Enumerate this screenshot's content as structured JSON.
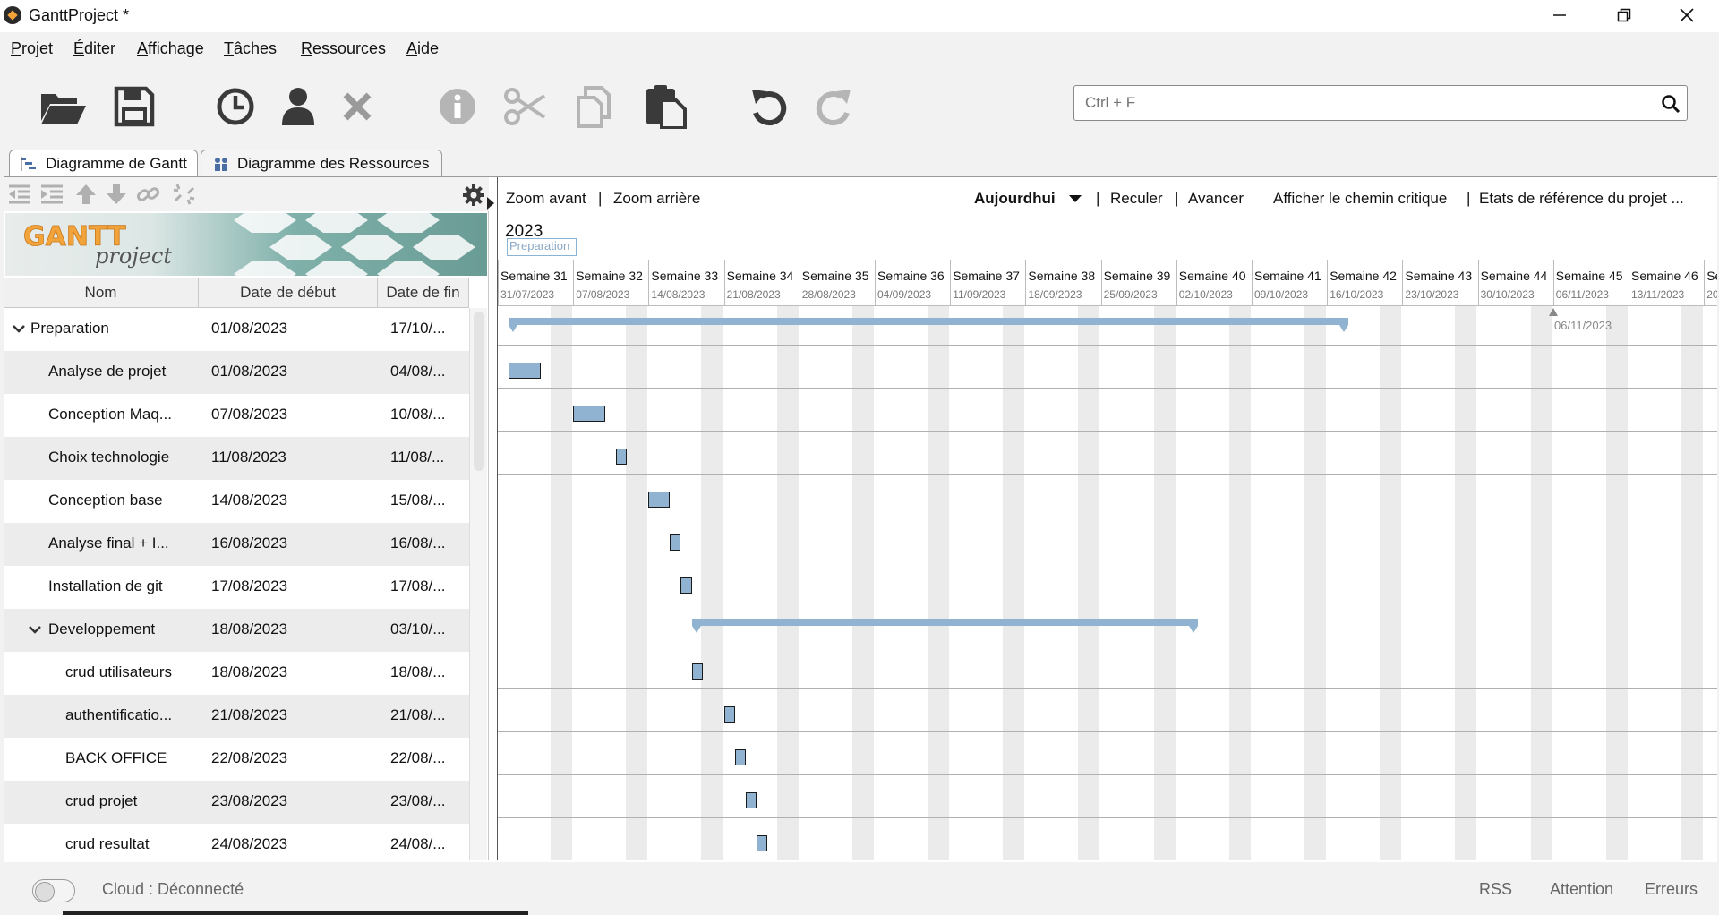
{
  "window": {
    "title": "GanttProject *"
  },
  "menu": [
    {
      "first": "P",
      "rest": "rojet"
    },
    {
      "first": "É",
      "rest": "diter"
    },
    {
      "first": "A",
      "rest": "ffichage"
    },
    {
      "first": "T",
      "rest": "âches"
    },
    {
      "first": "R",
      "rest": "essources"
    },
    {
      "first": "A",
      "rest": "ide"
    }
  ],
  "search": {
    "placeholder": "Ctrl + F"
  },
  "tabs": {
    "gantt": "Diagramme de Gantt",
    "resources": "Diagramme des Ressources"
  },
  "columns": {
    "name": "Nom",
    "start": "Date de début",
    "end": "Date de fin"
  },
  "tasks": [
    {
      "name": "Preparation",
      "start": "01/08/2023",
      "end": "17/10/...",
      "level": 0,
      "expandable": true
    },
    {
      "name": "Analyse de projet",
      "start": "01/08/2023",
      "end": "04/08/...",
      "level": 1
    },
    {
      "name": "Conception Maq...",
      "start": "07/08/2023",
      "end": "10/08/...",
      "level": 1
    },
    {
      "name": "Choix technologie",
      "start": "11/08/2023",
      "end": "11/08/...",
      "level": 1
    },
    {
      "name": "Conception base",
      "start": "14/08/2023",
      "end": "15/08/...",
      "level": 1
    },
    {
      "name": "Analyse final + I...",
      "start": "16/08/2023",
      "end": "16/08/...",
      "level": 1
    },
    {
      "name": "Installation de git",
      "start": "17/08/2023",
      "end": "17/08/...",
      "level": 1
    },
    {
      "name": "Developpement",
      "start": "18/08/2023",
      "end": "03/10/...",
      "level": 1,
      "expandable": true
    },
    {
      "name": "crud utilisateurs",
      "start": "18/08/2023",
      "end": "18/08/...",
      "level": 2
    },
    {
      "name": "authentificatio...",
      "start": "21/08/2023",
      "end": "21/08/...",
      "level": 2
    },
    {
      "name": "BACK OFFICE",
      "start": "22/08/2023",
      "end": "22/08/...",
      "level": 2
    },
    {
      "name": "crud projet",
      "start": "23/08/2023",
      "end": "23/08/...",
      "level": 2
    },
    {
      "name": "crud resultat",
      "start": "24/08/2023",
      "end": "24/08/...",
      "level": 2
    }
  ],
  "chart_toolbar": {
    "zoom_in": "Zoom avant",
    "zoom_out": "Zoom arrière",
    "today": "Aujourdhui",
    "back": "Reculer",
    "forward": "Avancer",
    "critical_path": "Afficher le chemin critique",
    "baselines": "Etats de référence du projet ..."
  },
  "timeline": {
    "year": "2023",
    "year_task_label": "Preparation",
    "weeks": [
      {
        "label": "Semaine 31",
        "date": "31/07/2023"
      },
      {
        "label": "Semaine 32",
        "date": "07/08/2023"
      },
      {
        "label": "Semaine 33",
        "date": "14/08/2023"
      },
      {
        "label": "Semaine 34",
        "date": "21/08/2023"
      },
      {
        "label": "Semaine 35",
        "date": "28/08/2023"
      },
      {
        "label": "Semaine 36",
        "date": "04/09/2023"
      },
      {
        "label": "Semaine 37",
        "date": "11/09/2023"
      },
      {
        "label": "Semaine 38",
        "date": "18/09/2023"
      },
      {
        "label": "Semaine 39",
        "date": "25/09/2023"
      },
      {
        "label": "Semaine 40",
        "date": "02/10/2023"
      },
      {
        "label": "Semaine 41",
        "date": "09/10/2023"
      },
      {
        "label": "Semaine 42",
        "date": "16/10/2023"
      },
      {
        "label": "Semaine 43",
        "date": "23/10/2023"
      },
      {
        "label": "Semaine 44",
        "date": "30/10/2023"
      },
      {
        "label": "Semaine 45",
        "date": "06/11/2023"
      },
      {
        "label": "Semaine 46",
        "date": "13/11/2023"
      },
      {
        "label": "Se",
        "date": "20"
      }
    ],
    "today_label": "06/11/2023"
  },
  "status": {
    "cloud": "Cloud : Déconnecté",
    "rss": "RSS",
    "warning": "Attention",
    "errors": "Erreurs"
  },
  "colors": {
    "accent": "#8fb3d0",
    "logo_orange": "#f2a33a",
    "logo_teal": "#6a9c96"
  }
}
